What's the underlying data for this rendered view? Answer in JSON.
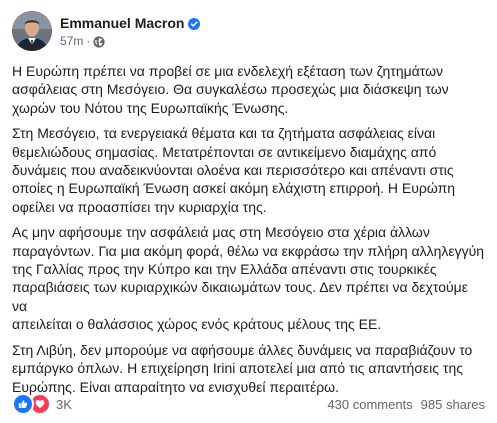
{
  "post": {
    "author": "Emmanuel Macron",
    "time": "57m",
    "separator": "·",
    "avatar_icon": "profile-photo",
    "verified_icon": "verified-badge-icon",
    "audience_icon": "globe-icon",
    "paragraphs": [
      "Η Ευρώπη πρέπει να προβεί σε μια ενδελεχή εξέταση των ζητημάτων\nασφάλειας στη Μεσόγειο. Θα συγκαλέσω προσεχώς μια διάσκεψη των\nχωρών του Νότου της Ευρωπαϊκής Ένωσης.",
      "Στη Μεσόγειο, τα ενεργειακά θέματα και τα ζητήματα ασφάλειας είναι\nθεμελιώδους σημασίας. Μετατρέπονται σε αντικείμενο διαμάχης από\nδυνάμεις που αναδεικνύονται ολοένα και περισσότερο και απέναντι στις\nοποίες η Ευρωπαϊκή Ένωση ασκεί ακόμη ελάχιστη επιρροή. Η Ευρώπη\nοφείλει να προασπίσει την κυριαρχία της.",
      "Ας μην αφήσουμε την ασφάλειά μας στη Μεσόγειο στα χέρια άλλων\nπαραγόντων. Για μια ακόμη φορά, θέλω να εκφράσω την πλήρη αλληλεγγύη\nτης Γαλλίας προς την Κύπρο και την Ελλάδα απέναντι στις τουρκικές\nπαραβιάσεις των κυριαρχικών δικαιωμάτων τους. Δεν πρέπει να δεχτούμε να\nαπειλείται ο θαλάσσιος χώρος ενός κράτους μέλους της ΕΕ.",
      "Στη Λιβύη, δεν μπορούμε να αφήσουμε άλλες δυνάμεις να παραβιάζουν το\nεμπάργκο όπλων. Η επιχείρηση Irini αποτελεί μια από τις απαντήσεις της\nΕυρώπης. Είναι απαραίτητο να ενισχυθεί περαιτέρω."
    ],
    "reactions": {
      "count": "3K",
      "icons": [
        "like-icon",
        "love-icon"
      ],
      "colors": {
        "like": "#1877f2",
        "love": "#f33e58"
      }
    },
    "comments": "430 comments",
    "shares": "985 shares"
  },
  "colors": {
    "text": "#1c1e21",
    "secondary": "#606770",
    "verified": "#1877f2"
  }
}
